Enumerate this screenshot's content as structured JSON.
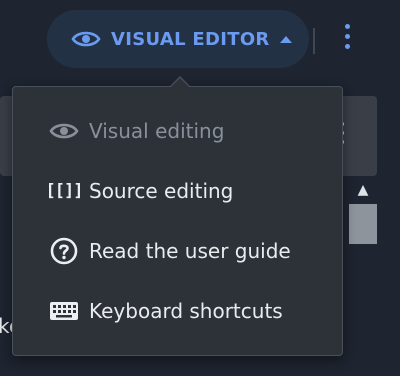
{
  "toolbar": {
    "mode_label": "VISUAL EDITOR",
    "mode_icon": "eye-icon",
    "caret_icon": "caret-up-icon",
    "more_icon": "vertical-ellipsis-icon",
    "accent_color": "#6b9bf0"
  },
  "menu": {
    "items": [
      {
        "label": "Visual editing",
        "icon": "eye-icon",
        "disabled": true
      },
      {
        "label": "Source editing",
        "icon": "wikitext-brackets-icon",
        "disabled": false
      },
      {
        "label": "Read the user guide",
        "icon": "help-circle-icon",
        "disabled": false
      },
      {
        "label": "Keyboard shortcuts",
        "icon": "keyboard-icon",
        "disabled": false
      }
    ],
    "brackets_glyph": "[[]]"
  },
  "background": {
    "partial_text": "ke"
  }
}
